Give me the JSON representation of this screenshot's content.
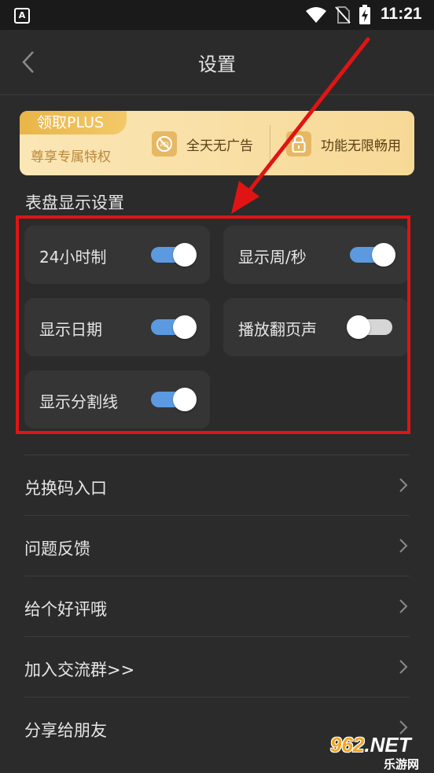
{
  "status_bar": {
    "app_icon_letter": "A",
    "time": "11:21"
  },
  "header": {
    "title": "设置"
  },
  "plus_banner": {
    "tag": "领取PLUS",
    "subtitle": "尊享专属特权",
    "features": [
      {
        "label": "全天无广告",
        "icon": "no-ads-icon"
      },
      {
        "label": "功能无限畅用",
        "icon": "lock-icon"
      }
    ],
    "colors": {
      "tag": "#e9b548",
      "background": "#f7d996"
    }
  },
  "section": {
    "title": "表盘显示设置"
  },
  "toggles": [
    {
      "label": "24小时制",
      "on": true
    },
    {
      "label": "显示周/秒",
      "on": true
    },
    {
      "label": "显示日期",
      "on": true
    },
    {
      "label": "播放翻页声",
      "on": false
    },
    {
      "label": "显示分割线",
      "on": true
    }
  ],
  "list_items": [
    {
      "label": "兑换码入口"
    },
    {
      "label": "问题反馈"
    },
    {
      "label": "给个好评哦"
    },
    {
      "label": "加入交流群>>"
    },
    {
      "label": "分享给朋友"
    }
  ],
  "watermark": {
    "main": "962",
    "net": ".NET",
    "sub": "乐游网"
  },
  "colors": {
    "background": "#2b2b2b",
    "card": "#353535",
    "switch_on": "#5b9ae0",
    "annotation": "#e01414"
  }
}
